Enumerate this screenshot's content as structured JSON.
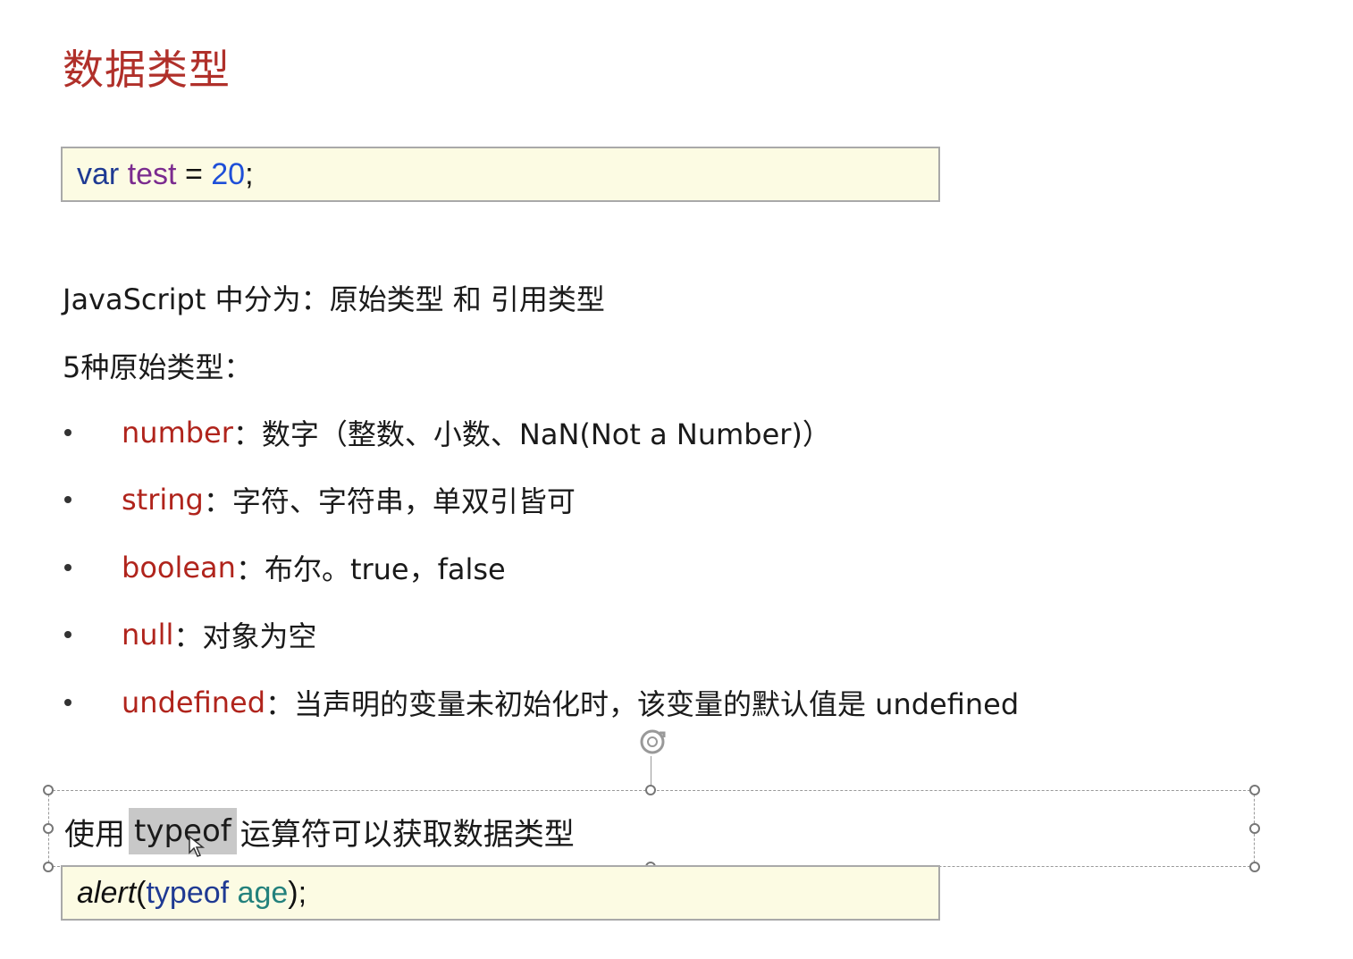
{
  "title": "数据类型",
  "code1": {
    "kw": "var",
    "name": "test",
    "eq": " = ",
    "value": "20",
    "end": ";"
  },
  "intro_line": "JavaScript 中分为：原始类型 和 引用类型",
  "primitive_header": "5种原始类型：",
  "bullets": [
    {
      "term": "number",
      "desc": "：数字（整数、小数、NaN(Not a Number)）"
    },
    {
      "term": "string",
      "desc": "：字符、字符串，单双引皆可"
    },
    {
      "term": "boolean",
      "desc": "：布尔。true，false"
    },
    {
      "term": "null",
      "desc": "：对象为空"
    },
    {
      "term": "undefined",
      "desc": "：当声明的变量未初始化时，该变量的默认值是 undefined"
    }
  ],
  "typeof_line": {
    "before": "使用",
    "highlight": "typeof",
    "after": "运算符可以获取数据类型"
  },
  "code2": {
    "fn": "alert",
    "open": "(",
    "kw": "typeof",
    "space": " ",
    "param": "age",
    "close": ");"
  }
}
